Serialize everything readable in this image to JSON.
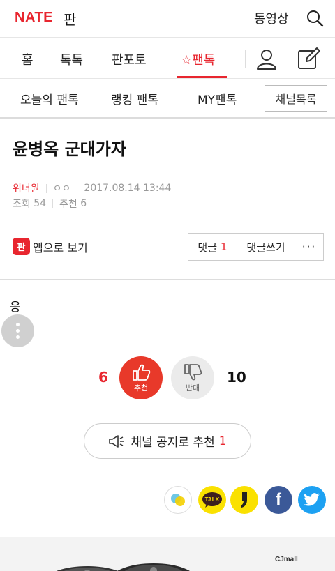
{
  "header": {
    "logo": "NATE",
    "logo_sub": "판",
    "video_label": "동영상",
    "search_icon": "search-icon"
  },
  "nav": {
    "tabs": [
      {
        "label": "홈"
      },
      {
        "label": "톡톡"
      },
      {
        "label": "판포토"
      },
      {
        "label": "☆팬톡",
        "active": true
      }
    ],
    "user_icon": "user-icon",
    "write_icon": "write-icon"
  },
  "subnav": {
    "items": [
      {
        "label": "오늘의 팬톡"
      },
      {
        "label": "랭킹 팬톡"
      },
      {
        "label": "MY팬톡"
      }
    ],
    "channel_button": "채널목록"
  },
  "post": {
    "title": "윤병옥 군대가자",
    "author": "워너원",
    "nickname": "ㅇㅇ",
    "datetime": "2017.08.14 13:44",
    "views_label": "조회",
    "views": "54",
    "recommend_label": "추천",
    "recommend": "6",
    "body": "응"
  },
  "actions": {
    "app_icon_text": "판",
    "app_view": "앱으로 보기",
    "comment_label": "댓글",
    "comment_count": "1",
    "write_comment": "댓글쓰기",
    "more": "···"
  },
  "vote": {
    "up_count": "6",
    "up_label": "추천",
    "down_label": "반대",
    "down_count": "10"
  },
  "notice": {
    "label": "채널 공지로 추천",
    "count": "1"
  },
  "share": {
    "icons": [
      "kakaostory-icon",
      "kakaotalk-icon",
      "kakaopage-icon",
      "facebook-icon",
      "twitter-icon"
    ],
    "talk_text": "TALK",
    "facebook_text": "f",
    "colors": {
      "kakaotalk": "#fae100",
      "facebook": "#3b5998",
      "twitter": "#1da1f2"
    }
  },
  "ad": {
    "brand": "CJmall"
  },
  "colors": {
    "accent": "#e8262f"
  }
}
